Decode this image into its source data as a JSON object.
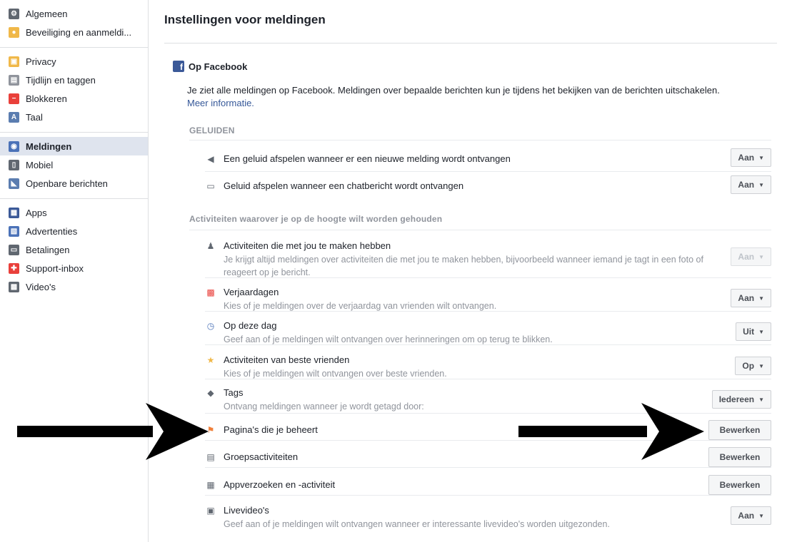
{
  "sidebar": {
    "groups": [
      [
        {
          "label": "Algemeen",
          "icon": "gears-icon",
          "color": "#606770"
        },
        {
          "label": "Beveiliging en aanmeldi...",
          "icon": "badge-icon",
          "color": "#f0b849"
        }
      ],
      [
        {
          "label": "Privacy",
          "icon": "privacy-icon",
          "color": "#f0b849"
        },
        {
          "label": "Tijdlijn en taggen",
          "icon": "timeline-icon",
          "color": "#90949c"
        },
        {
          "label": "Blokkeren",
          "icon": "block-icon",
          "color": "#e9403b"
        },
        {
          "label": "Taal",
          "icon": "language-icon",
          "color": "#5b7db0"
        }
      ],
      [
        {
          "label": "Meldingen",
          "icon": "globe-icon",
          "color": "#4b72b8",
          "active": true
        },
        {
          "label": "Mobiel",
          "icon": "mobile-icon",
          "color": "#606770"
        },
        {
          "label": "Openbare berichten",
          "icon": "rss-icon",
          "color": "#5b7db0"
        }
      ],
      [
        {
          "label": "Apps",
          "icon": "apps-icon",
          "color": "#3b5998"
        },
        {
          "label": "Advertenties",
          "icon": "ads-icon",
          "color": "#4b72b8"
        },
        {
          "label": "Betalingen",
          "icon": "card-icon",
          "color": "#606770"
        },
        {
          "label": "Support-inbox",
          "icon": "lifebuoy-icon",
          "color": "#e9403b"
        },
        {
          "label": "Video's",
          "icon": "film-icon",
          "color": "#606770"
        }
      ]
    ]
  },
  "main": {
    "title": "Instellingen voor meldingen",
    "section_title": "Op Facebook",
    "section_desc": "Je ziet alle meldingen op Facebook. Meldingen over bepaalde berichten kun je tijdens het bekijken van de berichten uitschakelen.",
    "more_info": "Meer informatie.",
    "sounds_head": "GELUIDEN",
    "sounds": [
      {
        "title": "Een geluid afspelen wanneer er een nieuwe melding wordt ontvangen",
        "value": "Aan",
        "icon": "speaker-icon"
      },
      {
        "title": "Geluid afspelen wanneer een chatbericht wordt ontvangen",
        "value": "Aan",
        "icon": "chat-icon"
      }
    ],
    "activities_head": "Activiteiten waarover je op de hoogte wilt worden gehouden",
    "activities": [
      {
        "title": "Activiteiten die met jou te maken hebben",
        "desc": "Je krijgt altijd meldingen over activiteiten die met jou te maken hebben, bijvoorbeeld wanneer iemand je tagt in een foto of reageert op je bericht.",
        "value": "Aan",
        "disabled": true,
        "icon": "person-icon",
        "kind": "dropdown"
      },
      {
        "title": "Verjaardagen",
        "desc": "Kies of je meldingen over de verjaardag van vrienden wilt ontvangen.",
        "value": "Aan",
        "icon": "gift-icon",
        "kind": "dropdown"
      },
      {
        "title": "Op deze dag",
        "desc": "Geef aan of je meldingen wilt ontvangen over herinneringen om op terug te blikken.",
        "value": "Uit",
        "icon": "clock-icon",
        "kind": "dropdown"
      },
      {
        "title": "Activiteiten van beste vrienden",
        "desc": "Kies of je meldingen wilt ontvangen over beste vrienden.",
        "value": "Op",
        "icon": "star-icon",
        "kind": "dropdown"
      },
      {
        "title": "Tags",
        "desc": "Ontvang meldingen wanneer je wordt getagd door:",
        "value": "Iedereen",
        "icon": "tag-icon",
        "kind": "dropdown"
      },
      {
        "title": "Pagina's die je beheert",
        "value": "Bewerken",
        "icon": "flag-icon",
        "kind": "button"
      },
      {
        "title": "Groepsactiviteiten",
        "value": "Bewerken",
        "icon": "group-icon",
        "kind": "button"
      },
      {
        "title": "Appverzoeken en -activiteit",
        "value": "Bewerken",
        "icon": "app-request-icon",
        "kind": "button"
      },
      {
        "title": "Livevideo's",
        "desc": "Geef aan of je meldingen wilt ontvangen wanneer er interessante livevideo's worden uitgezonden.",
        "value": "Aan",
        "icon": "video-camera-icon",
        "kind": "dropdown"
      }
    ]
  },
  "colors": {
    "link": "#365899",
    "active_bg": "#dfe4ee",
    "arrow": "#000000"
  }
}
